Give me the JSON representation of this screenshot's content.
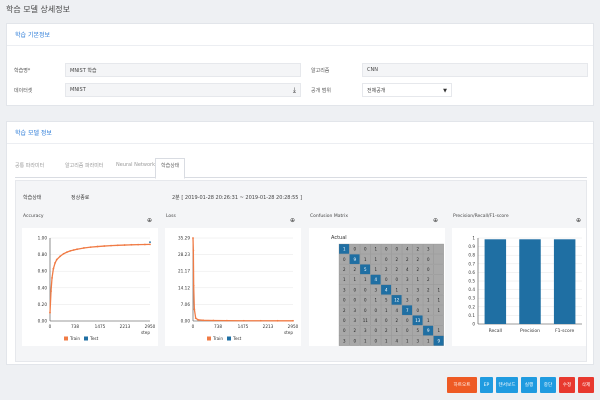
{
  "page": {
    "title": "학습 모델 상세정보"
  },
  "basic": {
    "header": "학습 기본정보",
    "name_label": "학습명*",
    "name_value": "MNIST 학습",
    "algo_label": "알고리즘",
    "algo_value": "CNN",
    "dataset_label": "데이터셋",
    "dataset_value": "MNIST",
    "scope_label": "공개 범위",
    "scope_value": "전체공개"
  },
  "model": {
    "header": "학습 모델 정보",
    "tabs": [
      "공통 파라미터",
      "알고리즘 파라미터",
      "Neural Network",
      "학습상태"
    ],
    "status_label": "학습상태",
    "status_value": "정상종료",
    "duration": "2분 [ 2019-01-28 20:26:31 ~ 2019-01-28 20:28:55 ]"
  },
  "charts": {
    "accuracy_title": "Accuracy",
    "loss_title": "Loss",
    "confusion_title": "Confusion Matrix",
    "confusion_label": "Actual",
    "prf_title": "Precision/Recall/F1-score",
    "legend_train": "Train",
    "legend_test": "Test",
    "step_label": "step"
  },
  "buttons": [
    {
      "label": "하트오트",
      "color": "#ee5a24"
    },
    {
      "label": "EP",
      "color": "#1f9be0"
    },
    {
      "label": "텐서보드",
      "color": "#1f9be0"
    },
    {
      "label": "실행",
      "color": "#1f9be0"
    },
    {
      "label": "중단",
      "color": "#1f9be0"
    },
    {
      "label": "수정",
      "color": "#e8392f"
    },
    {
      "label": "삭제",
      "color": "#e8392f"
    }
  ],
  "chart_data": [
    {
      "type": "line",
      "title": "Accuracy",
      "xlabel": "step",
      "x_ticks": [
        0,
        738,
        1475,
        2213,
        2950
      ],
      "y_ticks": [
        0,
        0.2,
        0.4,
        0.6,
        0.8,
        1.0
      ],
      "xlim": [
        0,
        2950
      ],
      "ylim": [
        0,
        1.0
      ],
      "series": [
        {
          "name": "Train",
          "color": "#f07b45",
          "x": [
            0,
            30,
            60,
            100,
            150,
            200,
            300,
            400,
            500,
            600,
            700,
            800,
            1000,
            1200,
            1400,
            1600,
            1800,
            2000,
            2200,
            2400,
            2600,
            2800,
            2950
          ],
          "y": [
            0.1,
            0.36,
            0.52,
            0.63,
            0.7,
            0.74,
            0.78,
            0.81,
            0.83,
            0.845,
            0.855,
            0.865,
            0.88,
            0.89,
            0.897,
            0.903,
            0.908,
            0.912,
            0.915,
            0.918,
            0.92,
            0.922,
            0.923
          ]
        },
        {
          "name": "Test",
          "color": "#1f6fa3",
          "x": [
            2950
          ],
          "y": [
            0.95
          ]
        }
      ],
      "tick_labels_y": [
        "0.00",
        "0.20",
        "0.40",
        "0.60",
        "0.80",
        "1.00"
      ],
      "tick_labels_x": [
        "0",
        "738",
        "1475",
        "2213",
        "2950"
      ]
    },
    {
      "type": "line",
      "title": "Loss",
      "xlabel": "step",
      "xlim": [
        0,
        2950
      ],
      "ylim": [
        0,
        35.29
      ],
      "series": [
        {
          "name": "Train",
          "color": "#f07b45",
          "x": [
            0,
            10,
            20,
            40,
            80,
            150,
            300,
            600,
            1000,
            1500,
            2000,
            2500,
            2950
          ],
          "y": [
            35.29,
            30,
            15,
            5,
            1.2,
            0.5,
            0.3,
            0.2,
            0.15,
            0.12,
            0.1,
            0.09,
            0.08
          ]
        },
        {
          "name": "Test",
          "color": "#1f6fa3",
          "x": [],
          "y": []
        }
      ],
      "tick_labels_y": [
        "0.00",
        "7.06",
        "14.12",
        "21.17",
        "28.23",
        "35.29"
      ],
      "tick_labels_x": [
        "0",
        "738",
        "1475",
        "2213",
        "2950"
      ]
    },
    {
      "type": "heatmap",
      "title": "Confusion Matrix",
      "ylabel": "Actual",
      "matrix": [
        [
          "1",
          "0",
          "0",
          "1",
          "0",
          "0",
          "4",
          "2",
          "3",
          ""
        ],
        [
          "0",
          "9",
          "1",
          "1",
          "0",
          "2",
          "2",
          "2",
          "0",
          ""
        ],
        [
          "2",
          "2",
          "5",
          "1",
          "2",
          "2",
          "4",
          "2",
          "0",
          ""
        ],
        [
          "1",
          "1",
          "1",
          "4",
          "0",
          "0",
          "3",
          "1",
          "2",
          ""
        ],
        [
          "3",
          "0",
          "0",
          "3",
          "4",
          "1",
          "1",
          "3",
          "2",
          "1"
        ],
        [
          "0",
          "0",
          "0",
          "1",
          "5",
          "12",
          "3",
          "0",
          "1",
          "1"
        ],
        [
          "2",
          "3",
          "0",
          "0",
          "1",
          "4",
          "7",
          "0",
          "1",
          "1"
        ],
        [
          "0",
          "3",
          "11",
          "4",
          "0",
          "2",
          "0",
          "13",
          "1",
          ""
        ],
        [
          "0",
          "2",
          "3",
          "0",
          "2",
          "1",
          "0",
          "5",
          "9",
          "1"
        ],
        [
          "3",
          "0",
          "1",
          "0",
          "1",
          "4",
          "1",
          "3",
          "1",
          "9"
        ]
      ]
    },
    {
      "type": "bar",
      "title": "Precision/Recall/F1-score",
      "categories": [
        "Recall",
        "Precision",
        "F1-score"
      ],
      "values": [
        0.985,
        0.985,
        0.985
      ],
      "ylim": [
        0,
        1.0
      ],
      "color": "#1f6fa3",
      "y_ticks": [
        "0",
        "0.1",
        "0.2",
        "0.3",
        "0.4",
        "0.5",
        "0.6",
        "0.7",
        "0.8",
        "0.9",
        "1"
      ]
    }
  ]
}
